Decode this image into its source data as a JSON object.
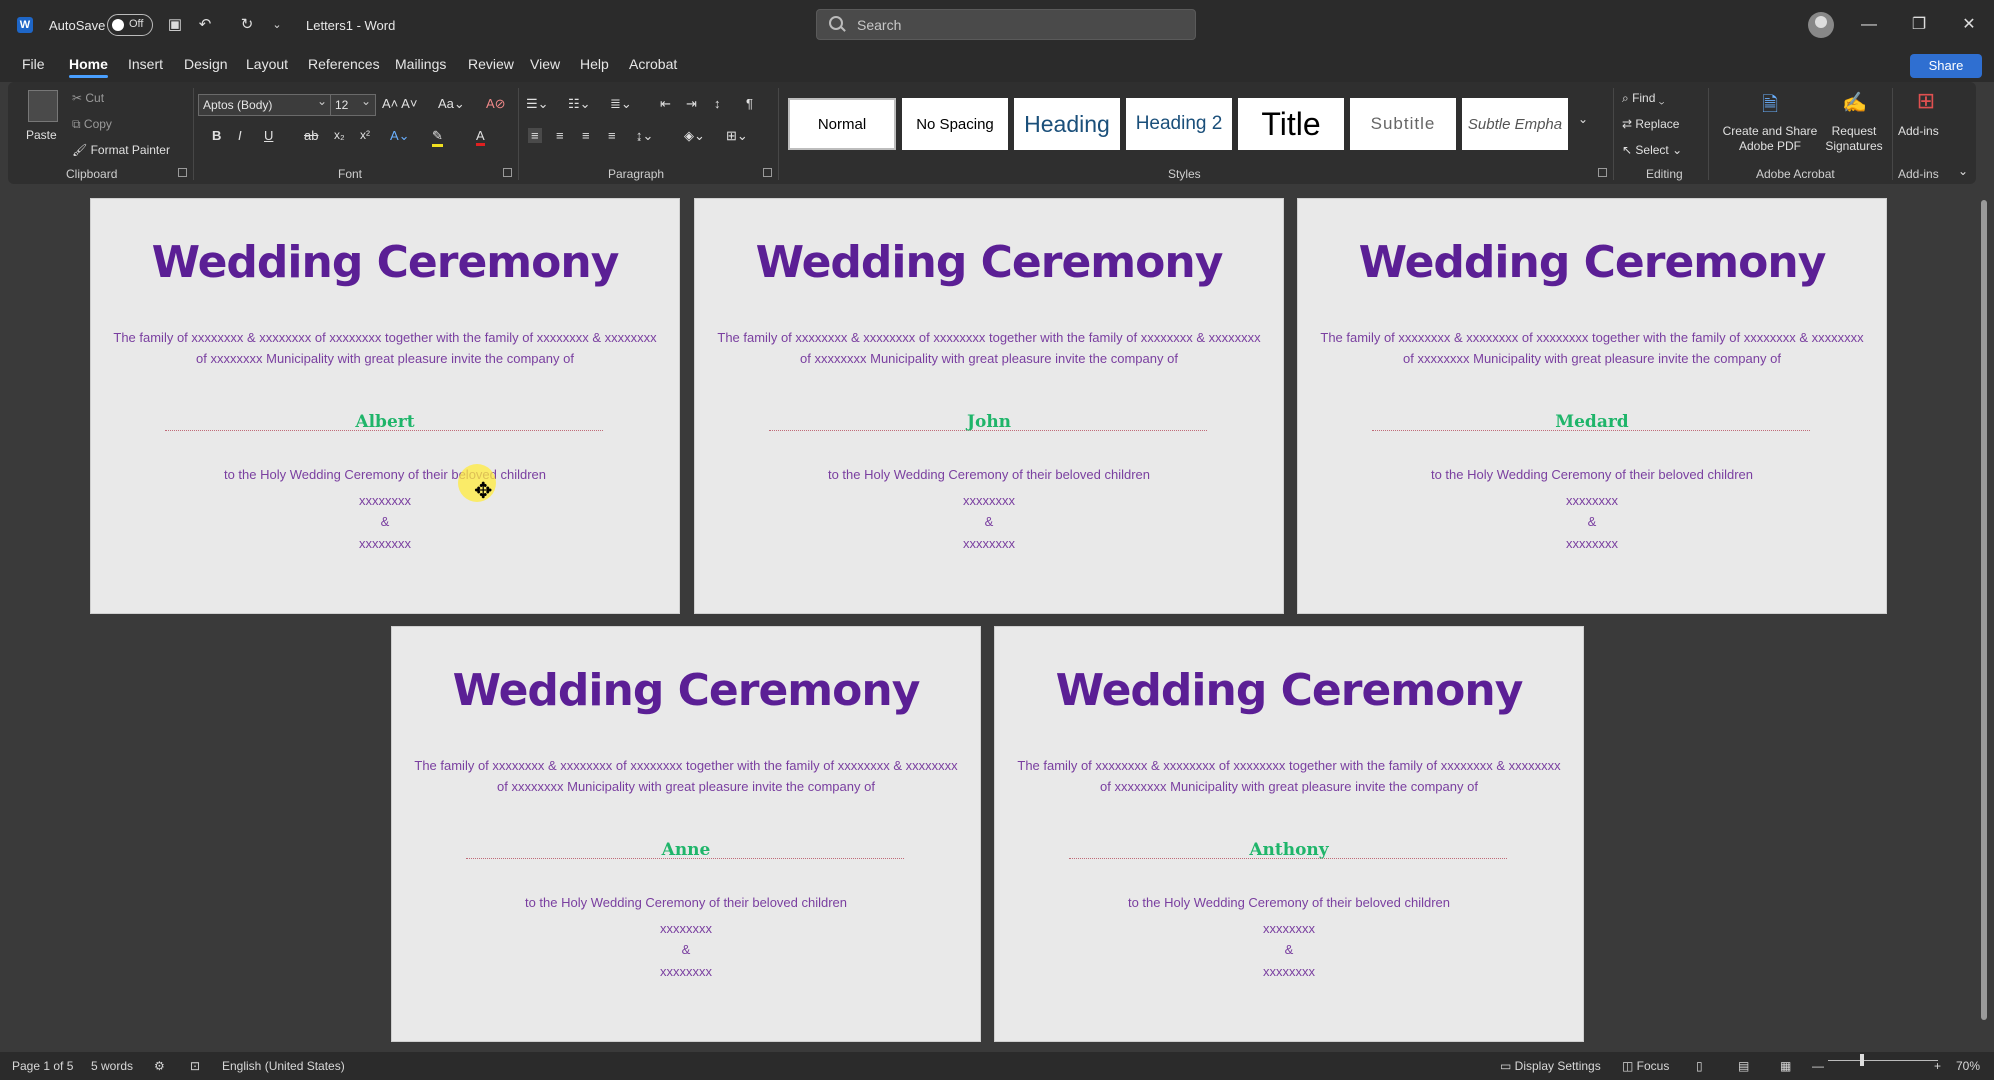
{
  "titlebar": {
    "autosave_label": "AutoSave",
    "autosave_state": "Off",
    "doc_title": "Letters1  -  Word",
    "search_placeholder": "Search"
  },
  "tabs": [
    "File",
    "Home",
    "Insert",
    "Design",
    "Layout",
    "References",
    "Mailings",
    "Review",
    "View",
    "Help",
    "Acrobat"
  ],
  "active_tab": "Home",
  "share_label": "Share",
  "ribbon": {
    "clipboard": {
      "paste": "Paste",
      "cut": "Cut",
      "copy": "Copy",
      "format_painter": "Format Painter",
      "label": "Clipboard"
    },
    "font": {
      "name": "Aptos (Body)",
      "size": "12",
      "label": "Font"
    },
    "paragraph": {
      "label": "Paragraph"
    },
    "styles": {
      "label": "Styles",
      "items": [
        "Normal",
        "No Spacing",
        "Heading",
        "Heading 2",
        "Title",
        "Subtitle",
        "Subtle Empha"
      ]
    },
    "editing": {
      "find": "Find",
      "replace": "Replace",
      "select": "Select",
      "label": "Editing"
    },
    "acrobat": {
      "create": "Create and Share Adobe PDF",
      "request": "Request Signatures",
      "label": "Adobe Acrobat"
    },
    "addins": {
      "button": "Add-ins",
      "label": "Add-ins"
    }
  },
  "pages": [
    {
      "title": "Wedding Ceremony",
      "para1": "The family of xxxxxxxx & xxxxxxxx of  xxxxxxxx together with the family of  xxxxxxxx & xxxxxxxx",
      "para2": "of xxxxxxxx Municipality with great pleasure invite the company of",
      "name": "Albert",
      "line2": "to the Holy Wedding Ceremony of their beloved children",
      "x1": "xxxxxxxx",
      "amp": "&",
      "x2": "xxxxxxxx"
    },
    {
      "title": "Wedding Ceremony",
      "para1": "The family of xxxxxxxx & xxxxxxxx of  xxxxxxxx together with the family of  xxxxxxxx & xxxxxxxx",
      "para2": "of xxxxxxxx Municipality with great pleasure invite the company of",
      "name": "John",
      "line2": "to the Holy Wedding Ceremony of their beloved children",
      "x1": "xxxxxxxx",
      "amp": "&",
      "x2": "xxxxxxxx"
    },
    {
      "title": "Wedding Ceremony",
      "para1": "The family of xxxxxxxx & xxxxxxxx of  xxxxxxxx together with the family of  xxxxxxxx & xxxxxxxx",
      "para2": "of xxxxxxxx Municipality with great pleasure invite the company of",
      "name": "Medard",
      "line2": "to the Holy Wedding Ceremony of their beloved children",
      "x1": "xxxxxxxx",
      "amp": "&",
      "x2": "xxxxxxxx"
    },
    {
      "title": "Wedding Ceremony",
      "para1": "The family of xxxxxxxx & xxxxxxxx of  xxxxxxxx together with the family of  xxxxxxxx & xxxxxxxx",
      "para2": "of xxxxxxxx Municipality with great pleasure invite the company of",
      "name": "Anne",
      "line2": "to the Holy Wedding Ceremony of their beloved children",
      "x1": "xxxxxxxx",
      "amp": "&",
      "x2": "xxxxxxxx"
    },
    {
      "title": "Wedding Ceremony",
      "para1": "The family of xxxxxxxx & xxxxxxxx of  xxxxxxxx together with the family of  xxxxxxxx & xxxxxxxx",
      "para2": "of xxxxxxxx Municipality with great pleasure invite the company of",
      "name": "Anthony",
      "line2": "to the Holy Wedding Ceremony of their beloved children",
      "x1": "xxxxxxxx",
      "amp": "&",
      "x2": "xxxxxxxx"
    }
  ],
  "statusbar": {
    "page": "Page 1 of 5",
    "words": "5 words",
    "language": "English (United States)",
    "display_settings": "Display Settings",
    "focus": "Focus",
    "zoom": "70%"
  },
  "colors": {
    "title": "#5b1f95",
    "name": "#1fb56a",
    "body_text": "#7a3fa0",
    "accent": "#2f6fd1"
  }
}
